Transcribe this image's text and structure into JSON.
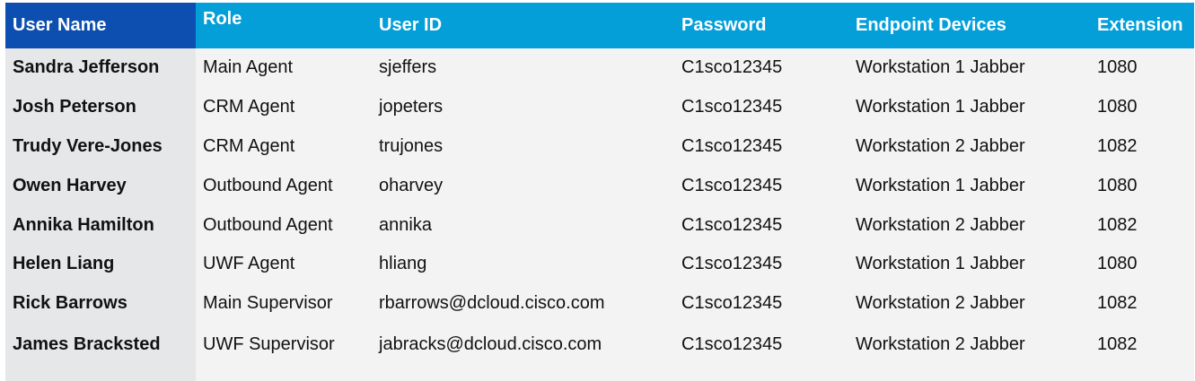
{
  "table": {
    "headers": [
      "User Name",
      "Role",
      "User ID",
      "Password",
      "Endpoint Devices",
      "Extension"
    ],
    "rows": [
      [
        "Sandra Jefferson",
        "Main Agent",
        "sjeffers",
        "C1sco12345",
        "Workstation 1 Jabber",
        "1080"
      ],
      [
        "Josh Peterson",
        "CRM Agent",
        "jopeters",
        "C1sco12345",
        "Workstation 1 Jabber",
        "1080"
      ],
      [
        "Trudy Vere-Jones",
        "CRM Agent",
        "trujones",
        "C1sco12345",
        "Workstation 2 Jabber",
        "1082"
      ],
      [
        "Owen Harvey",
        "Outbound Agent",
        "oharvey",
        "C1sco12345",
        "Workstation 1 Jabber",
        "1080"
      ],
      [
        "Annika Hamilton",
        "Outbound Agent",
        "annika",
        "C1sco12345",
        "Workstation 2 Jabber",
        "1082"
      ],
      [
        "Helen Liang",
        "UWF Agent",
        "hliang",
        "C1sco12345",
        "Workstation 1 Jabber",
        "1080"
      ],
      [
        "Rick Barrows",
        "Main Supervisor",
        "rbarrows@dcloud.cisco.com",
        "C1sco12345",
        "Workstation 2 Jabber",
        "1082"
      ],
      [
        "James Bracksted",
        "UWF Supervisor",
        "jabracks@dcloud.cisco.com",
        "C1sco12345",
        "Workstation 2 Jabber",
        "1082"
      ]
    ]
  },
  "colors": {
    "header_first": "#0d4fb0",
    "header": "#049fd9",
    "first_column": "#e6e7e8",
    "body": "#f3f3f3"
  }
}
